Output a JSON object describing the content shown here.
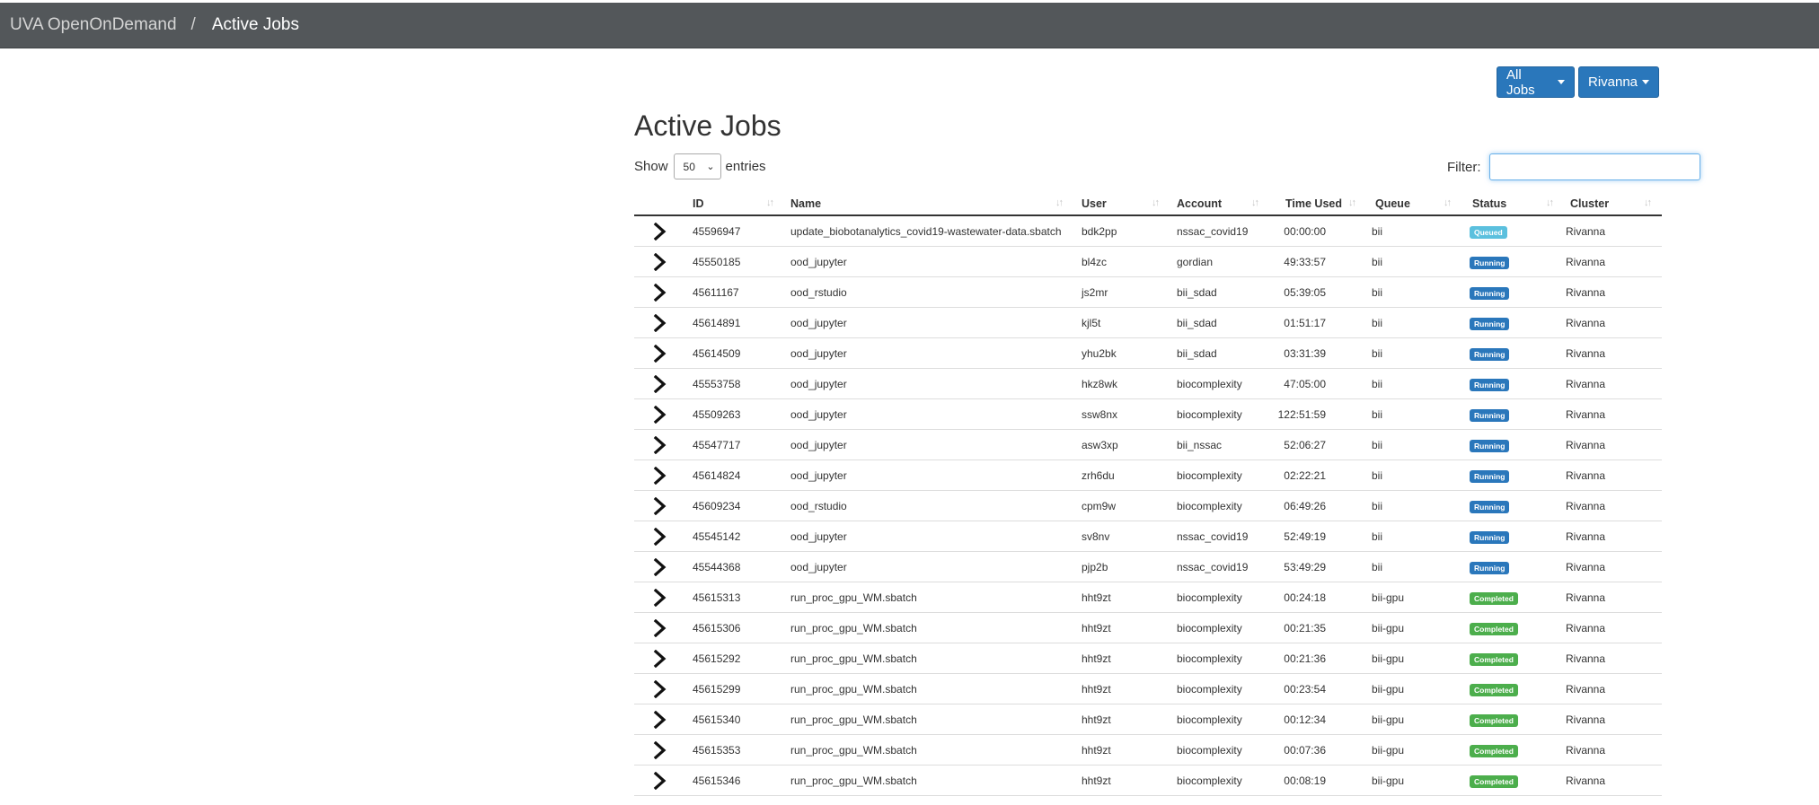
{
  "breadcrumb": {
    "home": "UVA OpenOnDemand",
    "separator": "/",
    "current": "Active Jobs"
  },
  "toolbar": {
    "jobs_filter_label": "All Jobs",
    "cluster_label": "Rivanna"
  },
  "page": {
    "title": "Active Jobs"
  },
  "length": {
    "show_label": "Show",
    "value": "50",
    "entries_label": "entries"
  },
  "filter": {
    "label": "Filter:",
    "value": ""
  },
  "table": {
    "columns": [
      "ID",
      "Name",
      "User",
      "Account",
      "Time Used",
      "Queue",
      "Status",
      "Cluster"
    ],
    "rows": [
      {
        "id": "45596947",
        "name": "update_biobotanalytics_covid19-wastewater-data.sbatch",
        "user": "bdk2pp",
        "account": "nssac_covid19",
        "time": "00:00:00",
        "queue": "bii",
        "status": "Queued",
        "cluster": "Rivanna"
      },
      {
        "id": "45550185",
        "name": "ood_jupyter",
        "user": "bl4zc",
        "account": "gordian",
        "time": "49:33:57",
        "queue": "bii",
        "status": "Running",
        "cluster": "Rivanna"
      },
      {
        "id": "45611167",
        "name": "ood_rstudio",
        "user": "js2mr",
        "account": "bii_sdad",
        "time": "05:39:05",
        "queue": "bii",
        "status": "Running",
        "cluster": "Rivanna"
      },
      {
        "id": "45614891",
        "name": "ood_jupyter",
        "user": "kjl5t",
        "account": "bii_sdad",
        "time": "01:51:17",
        "queue": "bii",
        "status": "Running",
        "cluster": "Rivanna"
      },
      {
        "id": "45614509",
        "name": "ood_jupyter",
        "user": "yhu2bk",
        "account": "bii_sdad",
        "time": "03:31:39",
        "queue": "bii",
        "status": "Running",
        "cluster": "Rivanna"
      },
      {
        "id": "45553758",
        "name": "ood_jupyter",
        "user": "hkz8wk",
        "account": "biocomplexity",
        "time": "47:05:00",
        "queue": "bii",
        "status": "Running",
        "cluster": "Rivanna"
      },
      {
        "id": "45509263",
        "name": "ood_jupyter",
        "user": "ssw8nx",
        "account": "biocomplexity",
        "time": "122:51:59",
        "queue": "bii",
        "status": "Running",
        "cluster": "Rivanna"
      },
      {
        "id": "45547717",
        "name": "ood_jupyter",
        "user": "asw3xp",
        "account": "bii_nssac",
        "time": "52:06:27",
        "queue": "bii",
        "status": "Running",
        "cluster": "Rivanna"
      },
      {
        "id": "45614824",
        "name": "ood_jupyter",
        "user": "zrh6du",
        "account": "biocomplexity",
        "time": "02:22:21",
        "queue": "bii",
        "status": "Running",
        "cluster": "Rivanna"
      },
      {
        "id": "45609234",
        "name": "ood_rstudio",
        "user": "cpm9w",
        "account": "biocomplexity",
        "time": "06:49:26",
        "queue": "bii",
        "status": "Running",
        "cluster": "Rivanna"
      },
      {
        "id": "45545142",
        "name": "ood_jupyter",
        "user": "sv8nv",
        "account": "nssac_covid19",
        "time": "52:49:19",
        "queue": "bii",
        "status": "Running",
        "cluster": "Rivanna"
      },
      {
        "id": "45544368",
        "name": "ood_jupyter",
        "user": "pjp2b",
        "account": "nssac_covid19",
        "time": "53:49:29",
        "queue": "bii",
        "status": "Running",
        "cluster": "Rivanna"
      },
      {
        "id": "45615313",
        "name": "run_proc_gpu_WM.sbatch",
        "user": "hht9zt",
        "account": "biocomplexity",
        "time": "00:24:18",
        "queue": "bii-gpu",
        "status": "Completed",
        "cluster": "Rivanna"
      },
      {
        "id": "45615306",
        "name": "run_proc_gpu_WM.sbatch",
        "user": "hht9zt",
        "account": "biocomplexity",
        "time": "00:21:35",
        "queue": "bii-gpu",
        "status": "Completed",
        "cluster": "Rivanna"
      },
      {
        "id": "45615292",
        "name": "run_proc_gpu_WM.sbatch",
        "user": "hht9zt",
        "account": "biocomplexity",
        "time": "00:21:36",
        "queue": "bii-gpu",
        "status": "Completed",
        "cluster": "Rivanna"
      },
      {
        "id": "45615299",
        "name": "run_proc_gpu_WM.sbatch",
        "user": "hht9zt",
        "account": "biocomplexity",
        "time": "00:23:54",
        "queue": "bii-gpu",
        "status": "Completed",
        "cluster": "Rivanna"
      },
      {
        "id": "45615340",
        "name": "run_proc_gpu_WM.sbatch",
        "user": "hht9zt",
        "account": "biocomplexity",
        "time": "00:12:34",
        "queue": "bii-gpu",
        "status": "Completed",
        "cluster": "Rivanna"
      },
      {
        "id": "45615353",
        "name": "run_proc_gpu_WM.sbatch",
        "user": "hht9zt",
        "account": "biocomplexity",
        "time": "00:07:36",
        "queue": "bii-gpu",
        "status": "Completed",
        "cluster": "Rivanna"
      },
      {
        "id": "45615346",
        "name": "run_proc_gpu_WM.sbatch",
        "user": "hht9zt",
        "account": "biocomplexity",
        "time": "00:08:19",
        "queue": "bii-gpu",
        "status": "Completed",
        "cluster": "Rivanna"
      }
    ]
  },
  "status_colors": {
    "Queued": "#5bc0de",
    "Running": "#2a77bb",
    "Completed": "#4cae4c"
  },
  "icons": {
    "expand": "chevron-right-icon",
    "sort": "sort-icon",
    "dropdown": "caret-down-icon"
  }
}
